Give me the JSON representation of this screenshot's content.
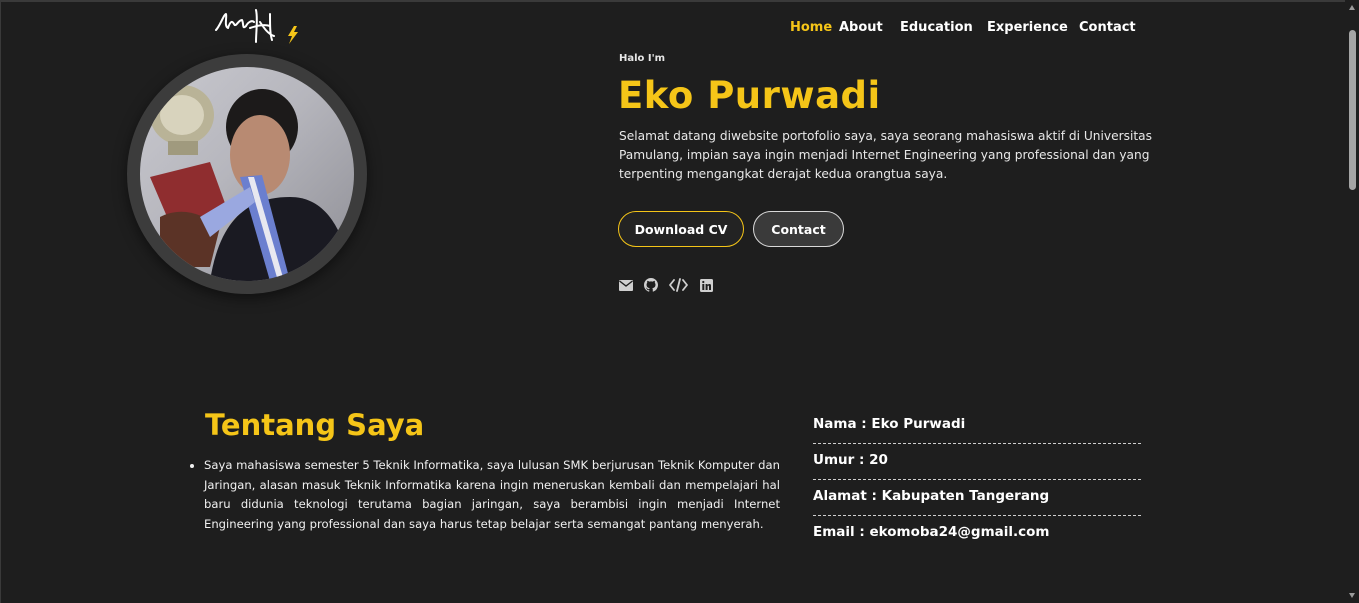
{
  "header": {
    "nav": [
      {
        "label": "Home",
        "active": true
      },
      {
        "label": "About",
        "active": false
      },
      {
        "label": "Education",
        "active": false
      },
      {
        "label": "Experience",
        "active": false
      },
      {
        "label": "Contact",
        "active": false
      }
    ]
  },
  "hero": {
    "greeting": "Halo I'm",
    "name": "Eko Purwadi",
    "description": "Selamat datang diwebsite portofolio saya, saya seorang mahasiswa aktif di Universitas Pamulang, impian saya ingin menjadi Internet Engineering yang professional dan yang terpenting mengangkat derajat kedua orangtua saya.",
    "buttons": {
      "download_cv": "Download CV",
      "contact": "Contact"
    },
    "social_icons": [
      "envelope-icon",
      "github-icon",
      "code-icon",
      "linkedin-icon"
    ]
  },
  "about": {
    "title": "Tentang Saya",
    "text": "Saya mahasiswa semester 5 Teknik Informatika, saya lulusan SMK berjurusan Teknik Komputer dan Jaringan, alasan masuk Teknik Informatika karena ingin meneruskan kembali dan mempelajari hal baru didunia teknologi terutama bagian jaringan, saya berambisi ingin menjadi Internet Engineering yang professional dan saya harus tetap belajar serta semangat pantang menyerah.",
    "info": [
      "Nama : Eko Purwadi",
      "Umur : 20",
      "Alamat : Kabupaten Tangerang",
      "Email : ekomoba24@gmail.com"
    ]
  },
  "colors": {
    "accent": "#f5c518",
    "background": "#1e1e1e",
    "text": "#ffffff"
  }
}
